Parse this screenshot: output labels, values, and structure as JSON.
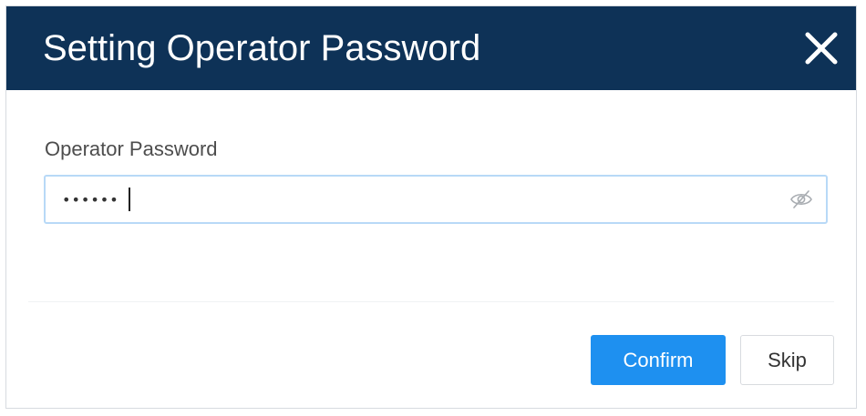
{
  "dialog": {
    "title": "Setting Operator Password",
    "close_icon": "close-icon"
  },
  "form": {
    "password_label": "Operator Password",
    "password_value": "••••••",
    "password_placeholder": "",
    "visibility_icon": "eye-slash-icon"
  },
  "actions": {
    "confirm_label": "Confirm",
    "skip_label": "Skip"
  },
  "colors": {
    "titlebar": "#0e3257",
    "primary": "#1e90f0",
    "input_focus_border": "#b8d9f7"
  }
}
